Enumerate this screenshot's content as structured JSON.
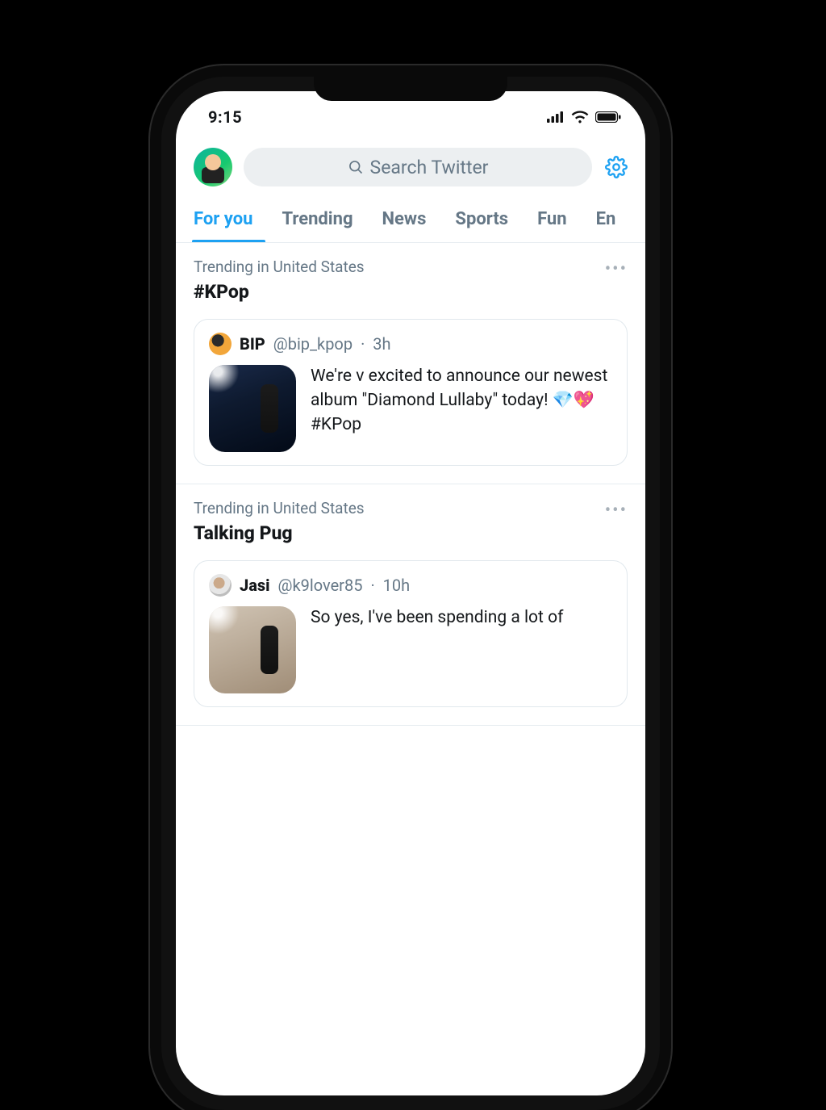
{
  "status": {
    "time": "9:15"
  },
  "header": {
    "search_placeholder": "Search Twitter"
  },
  "tabs": [
    {
      "label": "For you",
      "active": true
    },
    {
      "label": "Trending",
      "active": false
    },
    {
      "label": "News",
      "active": false
    },
    {
      "label": "Sports",
      "active": false
    },
    {
      "label": "Fun",
      "active": false
    },
    {
      "label": "En",
      "active": false
    }
  ],
  "trends": [
    {
      "context": "Trending in United States",
      "title": "#KPop",
      "tweet": {
        "name": "BIP",
        "handle": "@bip_kpop",
        "time": "3h",
        "text": "We're v excited to announce our newest album \"Diamond Lullaby\" today! 💎💖 #KPop"
      }
    },
    {
      "context": "Trending in United States",
      "title": "Talking Pug",
      "tweet": {
        "name": "Jasi",
        "handle": "@k9lover85",
        "time": "10h",
        "text": "So yes, I've been spending a lot of"
      }
    }
  ]
}
